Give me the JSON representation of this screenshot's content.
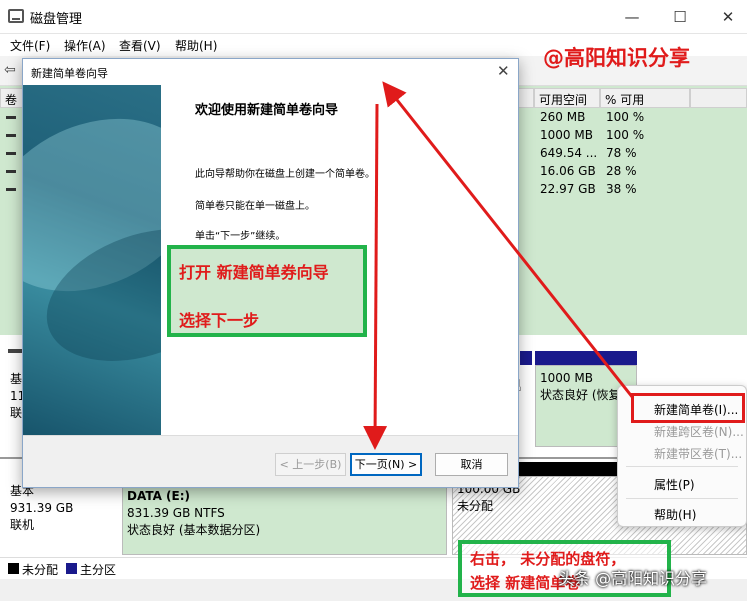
{
  "app": {
    "title": "磁盘管理",
    "menus": [
      "文件(F)",
      "操作(A)",
      "查看(V)",
      "帮助(H)"
    ],
    "window_buttons": {
      "minimize": "—",
      "maximize": "☐",
      "close": "✕"
    }
  },
  "table": {
    "headers": {
      "col_partial": "卷",
      "free": "可用空间",
      "pct": "% 可用"
    },
    "rows": [
      {
        "free": "260 MB",
        "pct": "100 %"
      },
      {
        "free": "1000 MB",
        "pct": "100 %"
      },
      {
        "free": "649.54 ...",
        "pct": "78 %"
      },
      {
        "free": "16.06 GB",
        "pct": "28 %"
      },
      {
        "free": "22.97 GB",
        "pct": "38 %"
      }
    ]
  },
  "disks": {
    "disk0": {
      "type_partial": "基",
      "size_partial": "11",
      "status_partial": "联"
    },
    "disk0_part": {
      "size": "1000 MB",
      "status": "状态良好 (恢复"
    },
    "disk1": {
      "type": "基本",
      "size": "931.39 GB",
      "status": "联机"
    },
    "data_part": {
      "name": "DATA  (E:)",
      "size": "831.39 GB NTFS",
      "status": "状态良好 (基本数据分区)"
    },
    "unalloc_part": {
      "size": "100.00 GB",
      "status": "未分配"
    }
  },
  "legend": {
    "unallocated": "未分配",
    "primary": "主分区"
  },
  "context_menu": {
    "items": [
      {
        "label": "新建简单卷(I)...",
        "enabled": true
      },
      {
        "label": "新建跨区卷(N)...",
        "enabled": false
      },
      {
        "label": "新建带区卷(T)...",
        "enabled": false
      },
      {
        "label": "属性(P)",
        "enabled": true
      },
      {
        "label": "帮助(H)",
        "enabled": true
      }
    ]
  },
  "wizard": {
    "title": "新建简单卷向导",
    "close": "✕",
    "heading": "欢迎使用新建简单卷向导",
    "line1": "此向导帮助你在磁盘上创建一个简单卷。",
    "line2": "简单卷只能在单一磁盘上。",
    "line3": "单击“下一步”继续。",
    "back_label": "< 上一步(B)",
    "next_label": "下一页(N) >",
    "cancel_label": "取消"
  },
  "annotations": {
    "brand": "@高阳知识分享",
    "box1_line1": "打开 新建简单券向导",
    "box1_line2": "选择下一步",
    "box2_line1": "右击， 未分配的盘符，",
    "box2_line2": "选择  新建简单卷",
    "watermark": "头条 @高阳知识分享"
  },
  "colors": {
    "annotation_red": "#e01b1b",
    "annotation_green": "#22b34a",
    "primary_partition": "#1a1a8c"
  }
}
